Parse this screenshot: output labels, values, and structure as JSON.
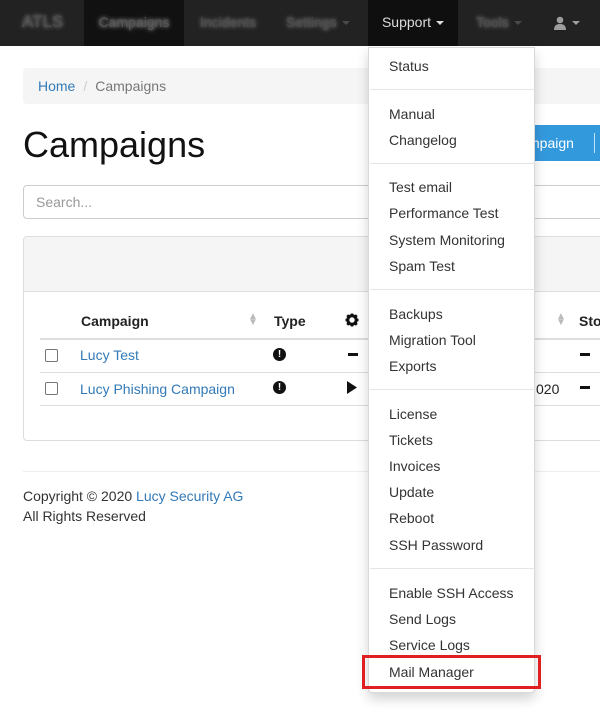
{
  "navbar": {
    "brand": "ATLS",
    "items": [
      {
        "label": "Campaigns"
      },
      {
        "label": "Incidents"
      },
      {
        "label": "Settings"
      },
      {
        "label": "Support"
      },
      {
        "label": "Tools"
      }
    ],
    "user_icon": "user-icon"
  },
  "breadcrumb": {
    "home": "Home",
    "separator": "/",
    "current": "Campaigns"
  },
  "page": {
    "title": "Campaigns",
    "new_button_label": "mpaign"
  },
  "search": {
    "placeholder": "Search..."
  },
  "table": {
    "headers": {
      "campaign": "Campaign",
      "type": "Type",
      "status_partial": "Sto"
    },
    "rows": [
      {
        "name": "Lucy Test",
        "date_partial": ""
      },
      {
        "name": "Lucy Phishing Campaign",
        "date_partial": "020"
      }
    ]
  },
  "footer": {
    "copyright": "Copyright © 2020 ",
    "company": "Lucy Security AG",
    "rights": "All Rights Reserved"
  },
  "dropdown": {
    "groups": [
      [
        "Status"
      ],
      [
        "Manual",
        "Changelog"
      ],
      [
        "Test email",
        "Performance Test",
        "System Monitoring",
        "Spam Test"
      ],
      [
        "Backups",
        "Migration Tool",
        "Exports"
      ],
      [
        "License",
        "Tickets",
        "Invoices",
        "Update",
        "Reboot",
        "SSH Password"
      ],
      [
        "Enable SSH Access",
        "Send Logs",
        "Service Logs",
        "Mail Manager"
      ]
    ]
  },
  "colors": {
    "navbar_bg": "#222222",
    "link": "#337ab7",
    "primary_button": "#3399dd",
    "highlight_box": "#e02020"
  }
}
